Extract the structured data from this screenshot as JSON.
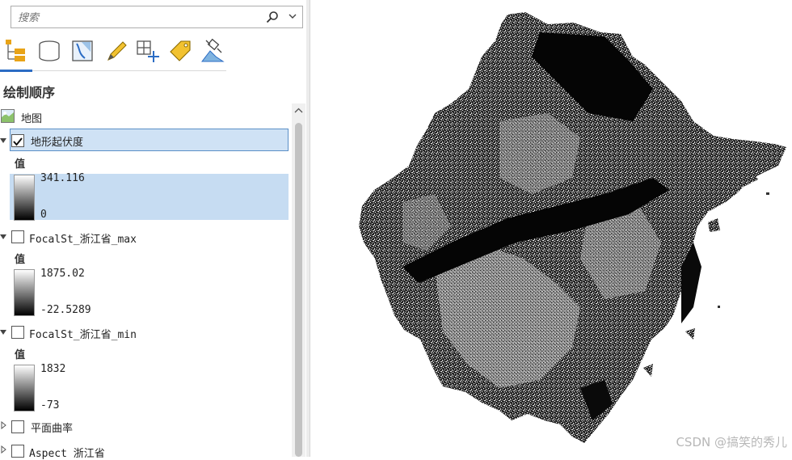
{
  "search": {
    "placeholder": "搜索"
  },
  "toolbar": {
    "icons": [
      "list-by-drawing-order-icon",
      "list-by-source-icon",
      "list-by-selection-icon",
      "list-by-editing-icon",
      "list-by-snapping-icon",
      "list-by-labeling-icon",
      "list-by-perspective-imagery-icon"
    ]
  },
  "pane_title": "绘制顺序",
  "map_item": {
    "label": "地图"
  },
  "layers": [
    {
      "name": "地形起伏度",
      "checked": true,
      "expanded": true,
      "selected": true,
      "value_label": "值",
      "high": "341.116",
      "low": "0"
    },
    {
      "name": "FocalSt_浙江省_max",
      "checked": false,
      "expanded": true,
      "selected": false,
      "value_label": "值",
      "high": "1875.02",
      "low": "-22.5289"
    },
    {
      "name": "FocalSt_浙江省_min",
      "checked": false,
      "expanded": true,
      "selected": false,
      "value_label": "值",
      "high": "1832",
      "low": "-73"
    },
    {
      "name": "平面曲率",
      "checked": false,
      "expanded": false,
      "selected": false
    },
    {
      "name": "Aspect 浙江省",
      "checked": false,
      "expanded": false,
      "selected": false
    }
  ],
  "watermark": "CSDN @搞笑的秀儿",
  "colors": {
    "selection": "#cfe2f5",
    "selection_border": "#5b8fc7",
    "accent": "#2b6cc4"
  }
}
